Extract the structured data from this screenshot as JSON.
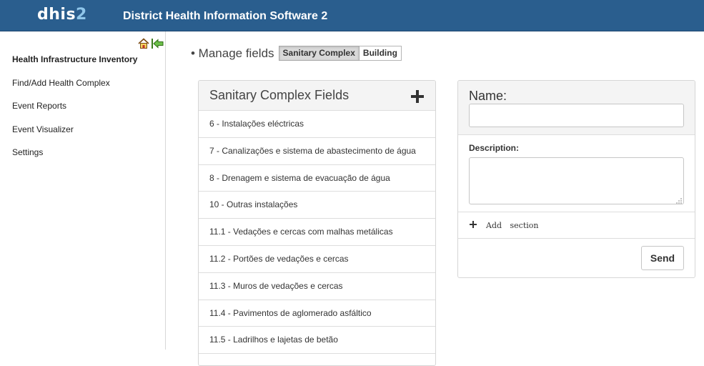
{
  "header": {
    "logo_text": "dhis",
    "logo_number": "2",
    "app_title": "District Health Information Software 2"
  },
  "sidebar": {
    "icons": [
      "home-icon",
      "back-arrow-icon"
    ],
    "items": [
      {
        "label": "Health Infrastructure Inventory"
      },
      {
        "label": "Find/Add Health Complex"
      },
      {
        "label": "Event Reports"
      },
      {
        "label": "Event Visualizer"
      },
      {
        "label": "Settings"
      }
    ]
  },
  "manage": {
    "label": "• Manage fields",
    "tabs": [
      {
        "label": "Sanitary Complex",
        "active": true
      },
      {
        "label": "Building",
        "active": false
      }
    ]
  },
  "fields_panel": {
    "title": "Sanitary Complex Fields",
    "items": [
      "6 - Instalações eléctricas",
      "7 - Canalizações e sistema de abastecimento de água",
      "8 - Drenagem e sistema de evacuação de água",
      "10 - Outras instalações",
      "11.1 - Vedações e cercas com malhas metálicas",
      "11.2 - Portões de vedações e cercas",
      "11.3 - Muros de vedações e cercas",
      "11.4 - Pavimentos de aglomerado asfáltico",
      "11.5 - Ladrilhos e lajetas de betão"
    ]
  },
  "form": {
    "name_label": "Name:",
    "name_value": "",
    "description_label": "Description:",
    "description_value": "",
    "add_section_label": "Add section",
    "send_label": "Send"
  },
  "colors": {
    "header_bg": "#2a5e8e",
    "logo_accent": "#8fc6ea"
  }
}
